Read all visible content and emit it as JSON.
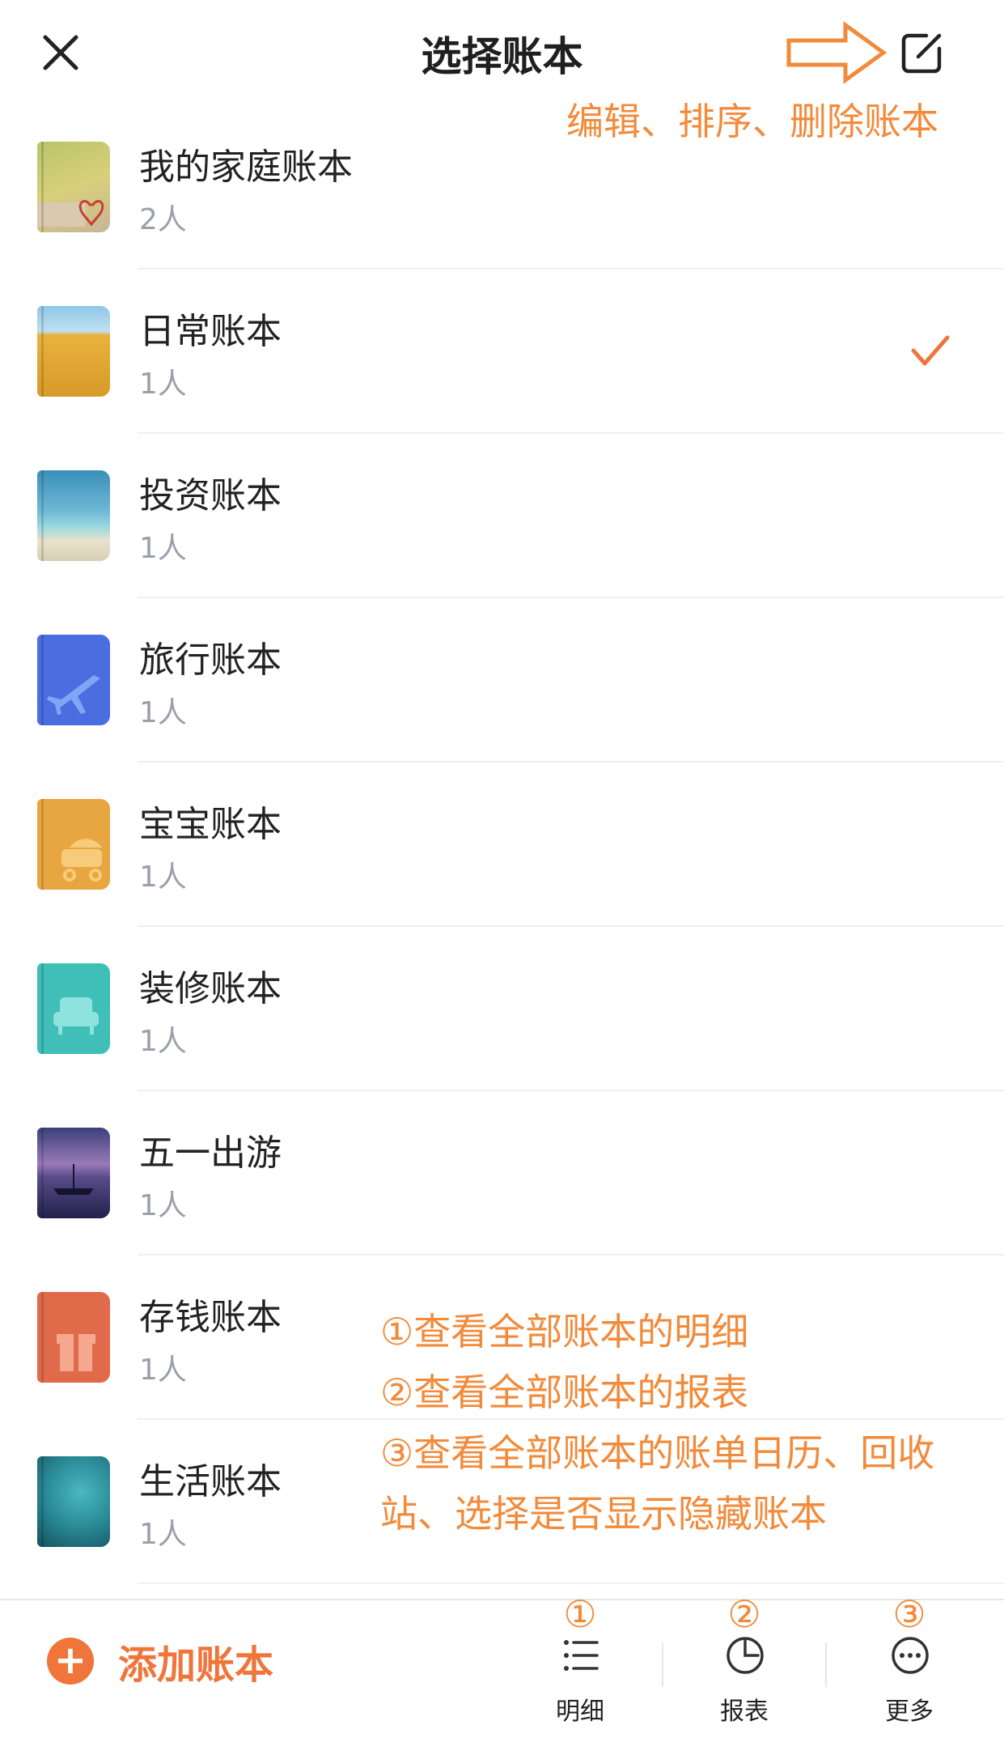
{
  "header": {
    "title": "选择账本",
    "edit_annotation": "编辑、排序、删除账本"
  },
  "books": [
    {
      "name": "我的家庭账本",
      "count": "2人",
      "selected": false
    },
    {
      "name": "日常账本",
      "count": "1人",
      "selected": true
    },
    {
      "name": "投资账本",
      "count": "1人",
      "selected": false
    },
    {
      "name": "旅行账本",
      "count": "1人",
      "selected": false
    },
    {
      "name": "宝宝账本",
      "count": "1人",
      "selected": false
    },
    {
      "name": "装修账本",
      "count": "1人",
      "selected": false
    },
    {
      "name": "五一出游",
      "count": "1人",
      "selected": false
    },
    {
      "name": "存钱账本",
      "count": "1人",
      "selected": false
    },
    {
      "name": "生活账本",
      "count": "1人",
      "selected": false
    }
  ],
  "annotations": {
    "line1": "①查看全部账本的明细",
    "line2": "②查看全部账本的报表",
    "line3": "③查看全部账本的账单日历、回收",
    "line4": "站、选择是否显示隐藏账本"
  },
  "bottom_bar": {
    "add_label": "添加账本",
    "add_icon": "+",
    "tabs": [
      {
        "num": "①",
        "label": "明细",
        "icon": "list-icon"
      },
      {
        "num": "②",
        "label": "报表",
        "icon": "pie-chart-icon"
      },
      {
        "num": "③",
        "label": "更多",
        "icon": "more-icon"
      }
    ]
  },
  "colors": {
    "accent": "#f0753a",
    "annotation": "#f28a3a"
  }
}
